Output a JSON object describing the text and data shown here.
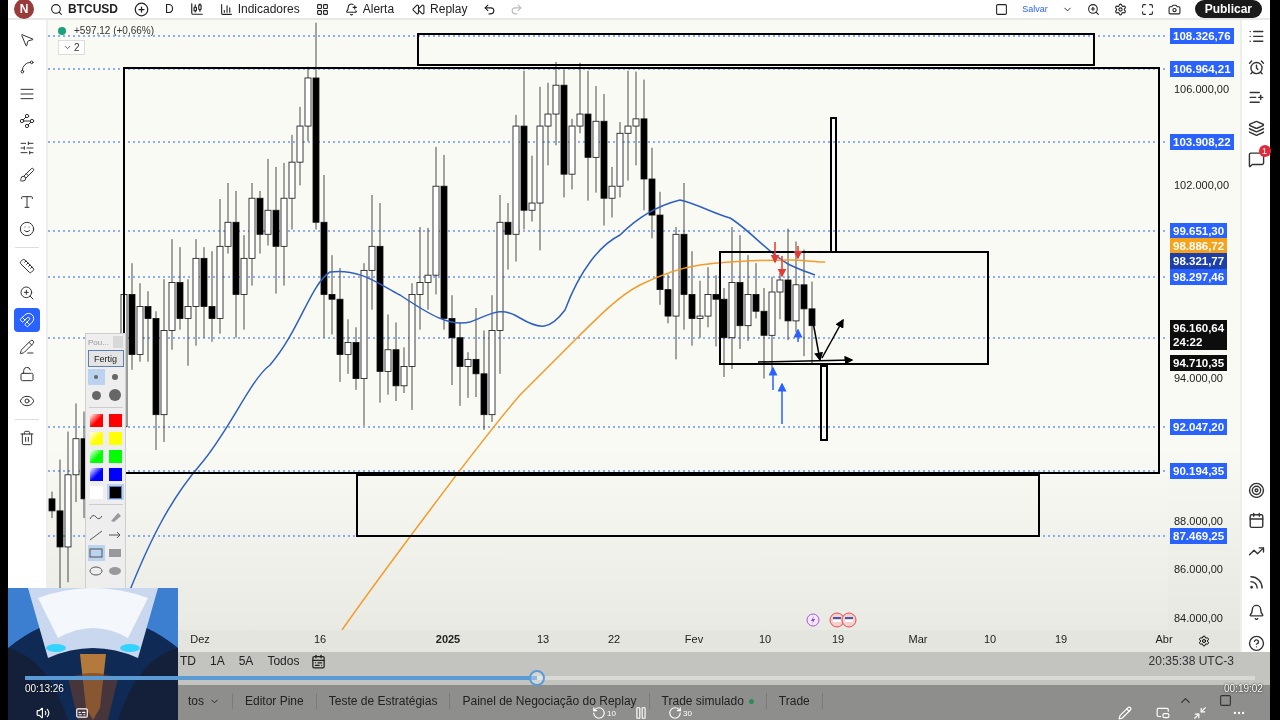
{
  "top_bar": {
    "avatar": "N",
    "symbol": "BTCUSD",
    "interval": "D",
    "indicators": "Indicadores",
    "alert": "Alerta",
    "replay": "Replay",
    "save": "Salvar",
    "publish": "Publicar"
  },
  "left_toolbar": {
    "tools": [
      {
        "kind": "cursor",
        "selected": false
      },
      {
        "kind": "trend-line",
        "selected": false
      },
      {
        "kind": "lines",
        "selected": false
      },
      {
        "kind": "pattern",
        "selected": false
      },
      {
        "kind": "sliders",
        "selected": false
      },
      {
        "kind": "brush",
        "selected": false
      },
      {
        "kind": "text",
        "selected": false
      },
      {
        "kind": "smiley",
        "selected": false
      },
      {
        "kind": "ruler",
        "selected": false
      },
      {
        "kind": "zoom",
        "selected": false
      },
      {
        "kind": "magnet",
        "selected": true
      },
      {
        "kind": "pencil",
        "selected": false
      },
      {
        "kind": "lock",
        "selected": false
      },
      {
        "kind": "eye",
        "selected": false
      },
      {
        "kind": "trash",
        "selected": false
      }
    ]
  },
  "legend": {
    "change": "+597,12 (+0,66%)",
    "indicator_count": "2"
  },
  "drawing_palette": {
    "title": "Pou...",
    "done": "Fertig",
    "sizes": [
      {
        "selected": true
      },
      {
        "selected": false
      },
      {
        "selected": false
      },
      {
        "selected": false
      }
    ],
    "colors": [
      {
        "kind": "fade",
        "color": "#ff0000",
        "selected": false
      },
      {
        "kind": "solid",
        "color": "#ff0000",
        "selected": false
      },
      {
        "kind": "fade",
        "color": "#ffff00",
        "selected": false
      },
      {
        "kind": "solid",
        "color": "#ffff00",
        "selected": false
      },
      {
        "kind": "fade",
        "color": "#00ff00",
        "selected": false
      },
      {
        "kind": "solid",
        "color": "#00ff00",
        "selected": false
      },
      {
        "kind": "fade",
        "color": "#0000ff",
        "selected": false
      },
      {
        "kind": "solid",
        "color": "#0000ff",
        "selected": false
      },
      {
        "kind": "solid",
        "color": "#ffffff",
        "selected": false
      },
      {
        "kind": "solid",
        "color": "#000000",
        "selected": true
      }
    ],
    "tools": [
      {
        "kind": "freehand",
        "selected": false
      },
      {
        "kind": "eraser",
        "selected": false
      },
      {
        "kind": "line",
        "selected": false
      },
      {
        "kind": "arrow",
        "selected": false
      },
      {
        "kind": "rectangle",
        "selected": true
      },
      {
        "kind": "filled-rectangle",
        "selected": false
      },
      {
        "kind": "ellipse",
        "selected": false
      },
      {
        "kind": "filled-ellipse",
        "selected": false
      }
    ]
  },
  "price_axis": {
    "labels": [
      {
        "text": "108.326,76",
        "kind": "tag",
        "color": "#2962ff"
      },
      {
        "text": "106.964,21",
        "kind": "tag",
        "color": "#2962ff"
      },
      {
        "text": "106.000,00",
        "kind": "plain"
      },
      {
        "text": "103.908,22",
        "kind": "tag",
        "color": "#2962ff"
      },
      {
        "text": "102.000,00",
        "kind": "plain"
      },
      {
        "text": "99.651,30",
        "kind": "tag",
        "color": "#2962ff"
      },
      {
        "text": "98.886,72",
        "kind": "tag",
        "color": "#f7a21b"
      },
      {
        "text": "98.321,77",
        "kind": "tag",
        "color": "#1c3faa"
      },
      {
        "text": "98.297,46",
        "kind": "tag",
        "color": "#2962ff"
      },
      {
        "text": "96.160,64",
        "kind": "tag",
        "color": "#0d0d0d",
        "countdown": "24:22"
      },
      {
        "text": "94.710,35",
        "kind": "tag",
        "color": "#0d0d0d"
      },
      {
        "text": "94.000,00",
        "kind": "plain"
      },
      {
        "text": "92.047,20",
        "kind": "tag",
        "color": "#2962ff"
      },
      {
        "text": "90.194,35",
        "kind": "tag",
        "color": "#2962ff"
      },
      {
        "text": "88.000,00",
        "kind": "plain"
      },
      {
        "text": "87.469,25",
        "kind": "tag",
        "color": "#2962ff"
      },
      {
        "text": "86.000,00",
        "kind": "plain"
      },
      {
        "text": "84.000,00",
        "kind": "plain"
      }
    ]
  },
  "time_axis": {
    "labels": [
      {
        "text": "Dez",
        "emphasized": false
      },
      {
        "text": "16",
        "emphasized": false
      },
      {
        "text": "2025",
        "emphasized": true
      },
      {
        "text": "13",
        "emphasized": false
      },
      {
        "text": "22",
        "emphasized": false
      },
      {
        "text": "Fev",
        "emphasized": false
      },
      {
        "text": "10",
        "emphasized": false
      },
      {
        "text": "19",
        "emphasized": false
      },
      {
        "text": "Mar",
        "emphasized": false
      },
      {
        "text": "10",
        "emphasized": false
      },
      {
        "text": "19",
        "emphasized": false
      },
      {
        "text": "Abr",
        "emphasized": false
      }
    ]
  },
  "right_sidebar": {
    "notification_count": "1"
  },
  "range_bar": {
    "ranges": [
      "TD",
      "1A",
      "5A",
      "Todos"
    ],
    "clock": "20:35:38 UTC-3"
  },
  "bottom_panel": {
    "tabs": [
      {
        "label": "tos",
        "dropdown": true,
        "status_dot": false
      },
      {
        "label": "Editor Pine",
        "dropdown": false,
        "status_dot": false
      },
      {
        "label": "Teste de Estratégias",
        "dropdown": false,
        "status_dot": false
      },
      {
        "label": "Painel de Negociação do Replay",
        "dropdown": false,
        "status_dot": false
      },
      {
        "label": "Trade simulado",
        "dropdown": false,
        "status_dot": true
      },
      {
        "label": "Trade",
        "dropdown": false,
        "status_dot": false
      }
    ]
  },
  "video_player": {
    "elapsed": "00:13:26",
    "duration": "00:19:02",
    "level": 0.416,
    "rewind_label": "10",
    "forward_label": "30"
  }
}
